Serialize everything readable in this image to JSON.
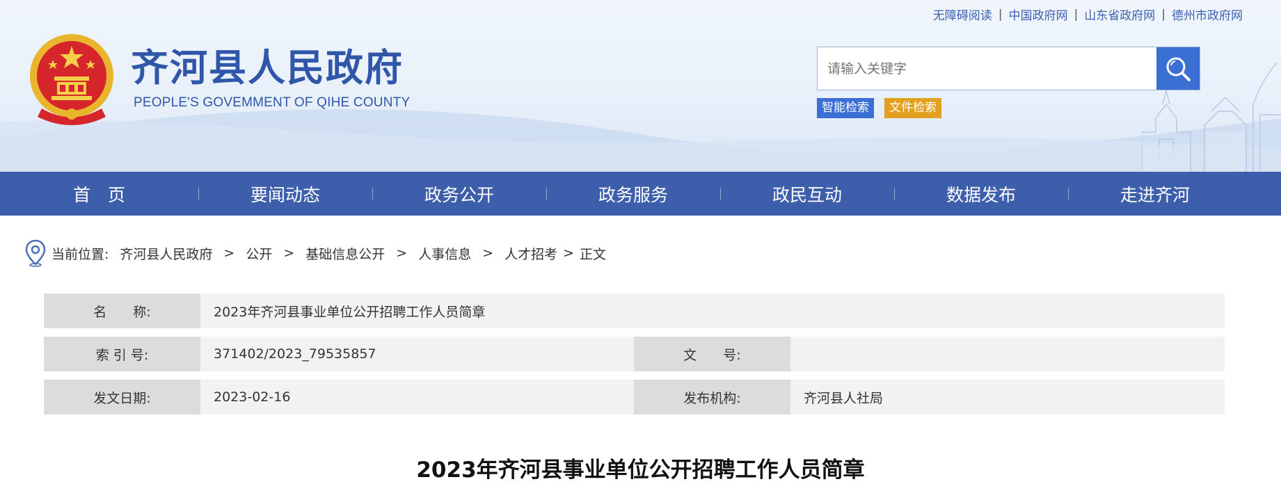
{
  "top_links": [
    "无障碍阅读",
    "中国政府网",
    "山东省政府网",
    "德州市政府网"
  ],
  "site": {
    "title": "齐河县人民政府",
    "subtitle": "PEOPLE'S GOVEMMENT OF QIHE COUNTY"
  },
  "search": {
    "placeholder": "请输入关键字",
    "smart_label": "智能检索",
    "file_label": "文件检索"
  },
  "nav": [
    "首　页",
    "要闻动态",
    "政务公开",
    "政务服务",
    "政民互动",
    "数据发布",
    "走进齐河"
  ],
  "breadcrumb": {
    "prefix": "当前位置:",
    "items": [
      "齐河县人民政府",
      "公开",
      "基础信息公开",
      "人事信息",
      "人才招考",
      "正文"
    ],
    "separator": ">"
  },
  "info": {
    "name_label": "名　　称:",
    "name_value": "2023年齐河县事业单位公开招聘工作人员简章",
    "index_label": "索 引 号:",
    "index_value": "371402/2023_79535857",
    "doc_no_label": "文　　号:",
    "doc_no_value": "",
    "date_label": "发文日期:",
    "date_value": "2023-02-16",
    "org_label": "发布机构:",
    "org_value": "齐河县人社局"
  },
  "article_title": "2023年齐河县事业单位公开招聘工作人员简章",
  "colors": {
    "brand_blue": "#2f56a8",
    "nav_bg": "#3c5eab",
    "search_btn": "#3b6fd4",
    "file_tag": "#e3a020"
  }
}
